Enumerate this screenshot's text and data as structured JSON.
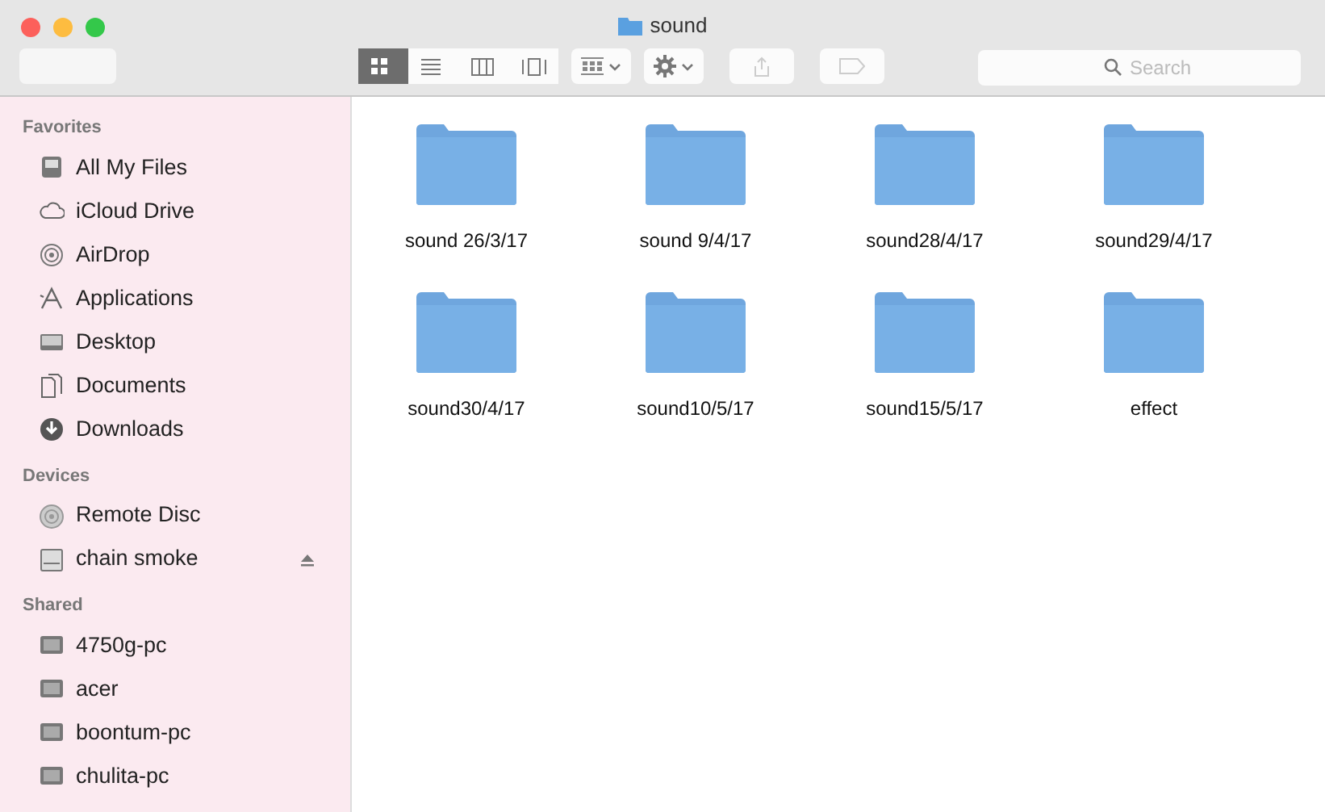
{
  "window": {
    "title": "sound"
  },
  "toolbar": {
    "view_modes": [
      {
        "kind": "icons",
        "selected": true
      },
      {
        "kind": "list",
        "selected": false
      },
      {
        "kind": "columns",
        "selected": false
      },
      {
        "kind": "coverflow",
        "selected": false
      }
    ],
    "menus": [
      {
        "kind": "arrange"
      },
      {
        "kind": "action"
      }
    ],
    "buttons": [
      {
        "kind": "share",
        "disabled": true
      },
      {
        "kind": "tag",
        "disabled": true
      }
    ],
    "search": {
      "placeholder": "Search"
    }
  },
  "sidebar": {
    "sections": [
      {
        "title": "Favorites",
        "items": [
          {
            "label": "All My Files",
            "kind": "files"
          },
          {
            "label": "iCloud Drive",
            "kind": "cloud"
          },
          {
            "label": "AirDrop",
            "kind": "airdrop"
          },
          {
            "label": "Applications",
            "kind": "apps"
          },
          {
            "label": "Desktop",
            "kind": "desktop"
          },
          {
            "label": "Documents",
            "kind": "documents"
          },
          {
            "label": "Downloads",
            "kind": "downloads"
          }
        ]
      },
      {
        "title": "Devices",
        "items": [
          {
            "label": "Remote Disc",
            "kind": "disc"
          },
          {
            "label": "chain smoke",
            "kind": "drive",
            "ejectable": true
          }
        ]
      },
      {
        "title": "Shared",
        "items": [
          {
            "label": "4750g-pc",
            "kind": "computer"
          },
          {
            "label": "acer",
            "kind": "computer"
          },
          {
            "label": "boontum-pc",
            "kind": "computer"
          },
          {
            "label": "chulita-pc",
            "kind": "computer"
          }
        ]
      }
    ]
  },
  "folders": [
    {
      "name": "sound 26/3/17"
    },
    {
      "name": "sound 9/4/17"
    },
    {
      "name": "sound28/4/17"
    },
    {
      "name": "sound29/4/17"
    },
    {
      "name": "sound30/4/17"
    },
    {
      "name": "sound10/5/17"
    },
    {
      "name": "sound15/5/17"
    },
    {
      "name": "effect"
    }
  ]
}
